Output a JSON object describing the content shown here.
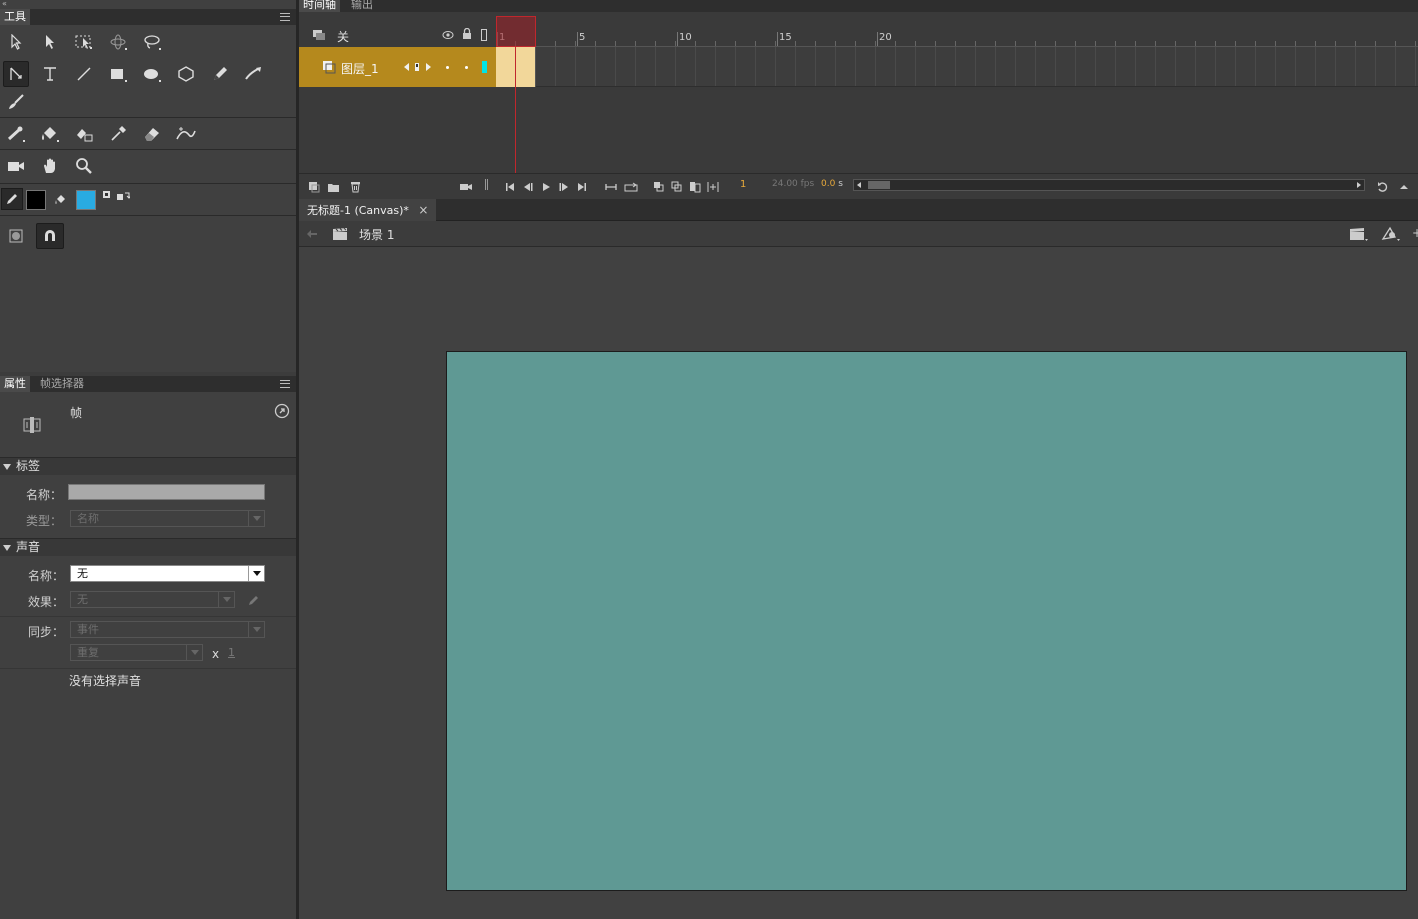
{
  "tools_panel": {
    "title": "工具"
  },
  "colors": {
    "stroke_swatch": "#000000",
    "fill_swatch": "#29abe2",
    "layer_highlight": "#b5891d",
    "playhead": "#c0272d",
    "stage": "#5f9994",
    "frame_span": "#f2d79a",
    "layer_tag": "#00e5e5"
  },
  "tool_icons": [
    "selection-tool-icon",
    "subselection-tool-icon",
    "free-transform-icon",
    "3d-rotation-icon",
    "lasso-icon",
    "line-pen-icon",
    "text-icon",
    "line-icon",
    "rectangle-icon",
    "oval-icon",
    "polystar-icon",
    "pencil-icon",
    "paint-brush-icon",
    "brush-icon",
    "bone-icon",
    "paint-bucket-icon",
    "ink-bottle-icon",
    "eyedropper-icon",
    "eraser-icon",
    "width-tool-icon",
    "camera-icon",
    "hand-icon",
    "zoom-icon"
  ],
  "props": {
    "tabs": [
      "属性",
      "帧选择器"
    ],
    "frame_label": "帧",
    "label_section": {
      "title": "标签",
      "name_label": "名称：",
      "name_value": "",
      "type_label": "类型：",
      "type_value": "名称"
    },
    "sound_section": {
      "title": "声音",
      "name_label": "名称：",
      "name_value": "无",
      "effect_label": "效果：",
      "effect_value": "无",
      "sync_label": "同步：",
      "sync_value": "事件",
      "repeat_value": "重复",
      "repeat_x": "x",
      "repeat_count": "1",
      "no_sound": "没有选择声音"
    }
  },
  "timeline": {
    "tabs": [
      "时间轴",
      "输出"
    ],
    "header_label": "关",
    "layer_name": "图层_1",
    "ruler_ticks": [
      {
        "frame": 1,
        "label": "1"
      },
      {
        "frame": 5,
        "label": "5"
      },
      {
        "frame": 10,
        "label": "10"
      },
      {
        "frame": 15,
        "label": "15"
      },
      {
        "frame": 20,
        "label": "20"
      }
    ],
    "current_frame": "1",
    "fps": "24.00",
    "fps_unit": "fps",
    "elapsed": "0.0",
    "elapsed_unit": "s"
  },
  "document": {
    "tab_title": "无标题-1 (Canvas)*",
    "close": "×",
    "scene_label": "场景 1"
  }
}
